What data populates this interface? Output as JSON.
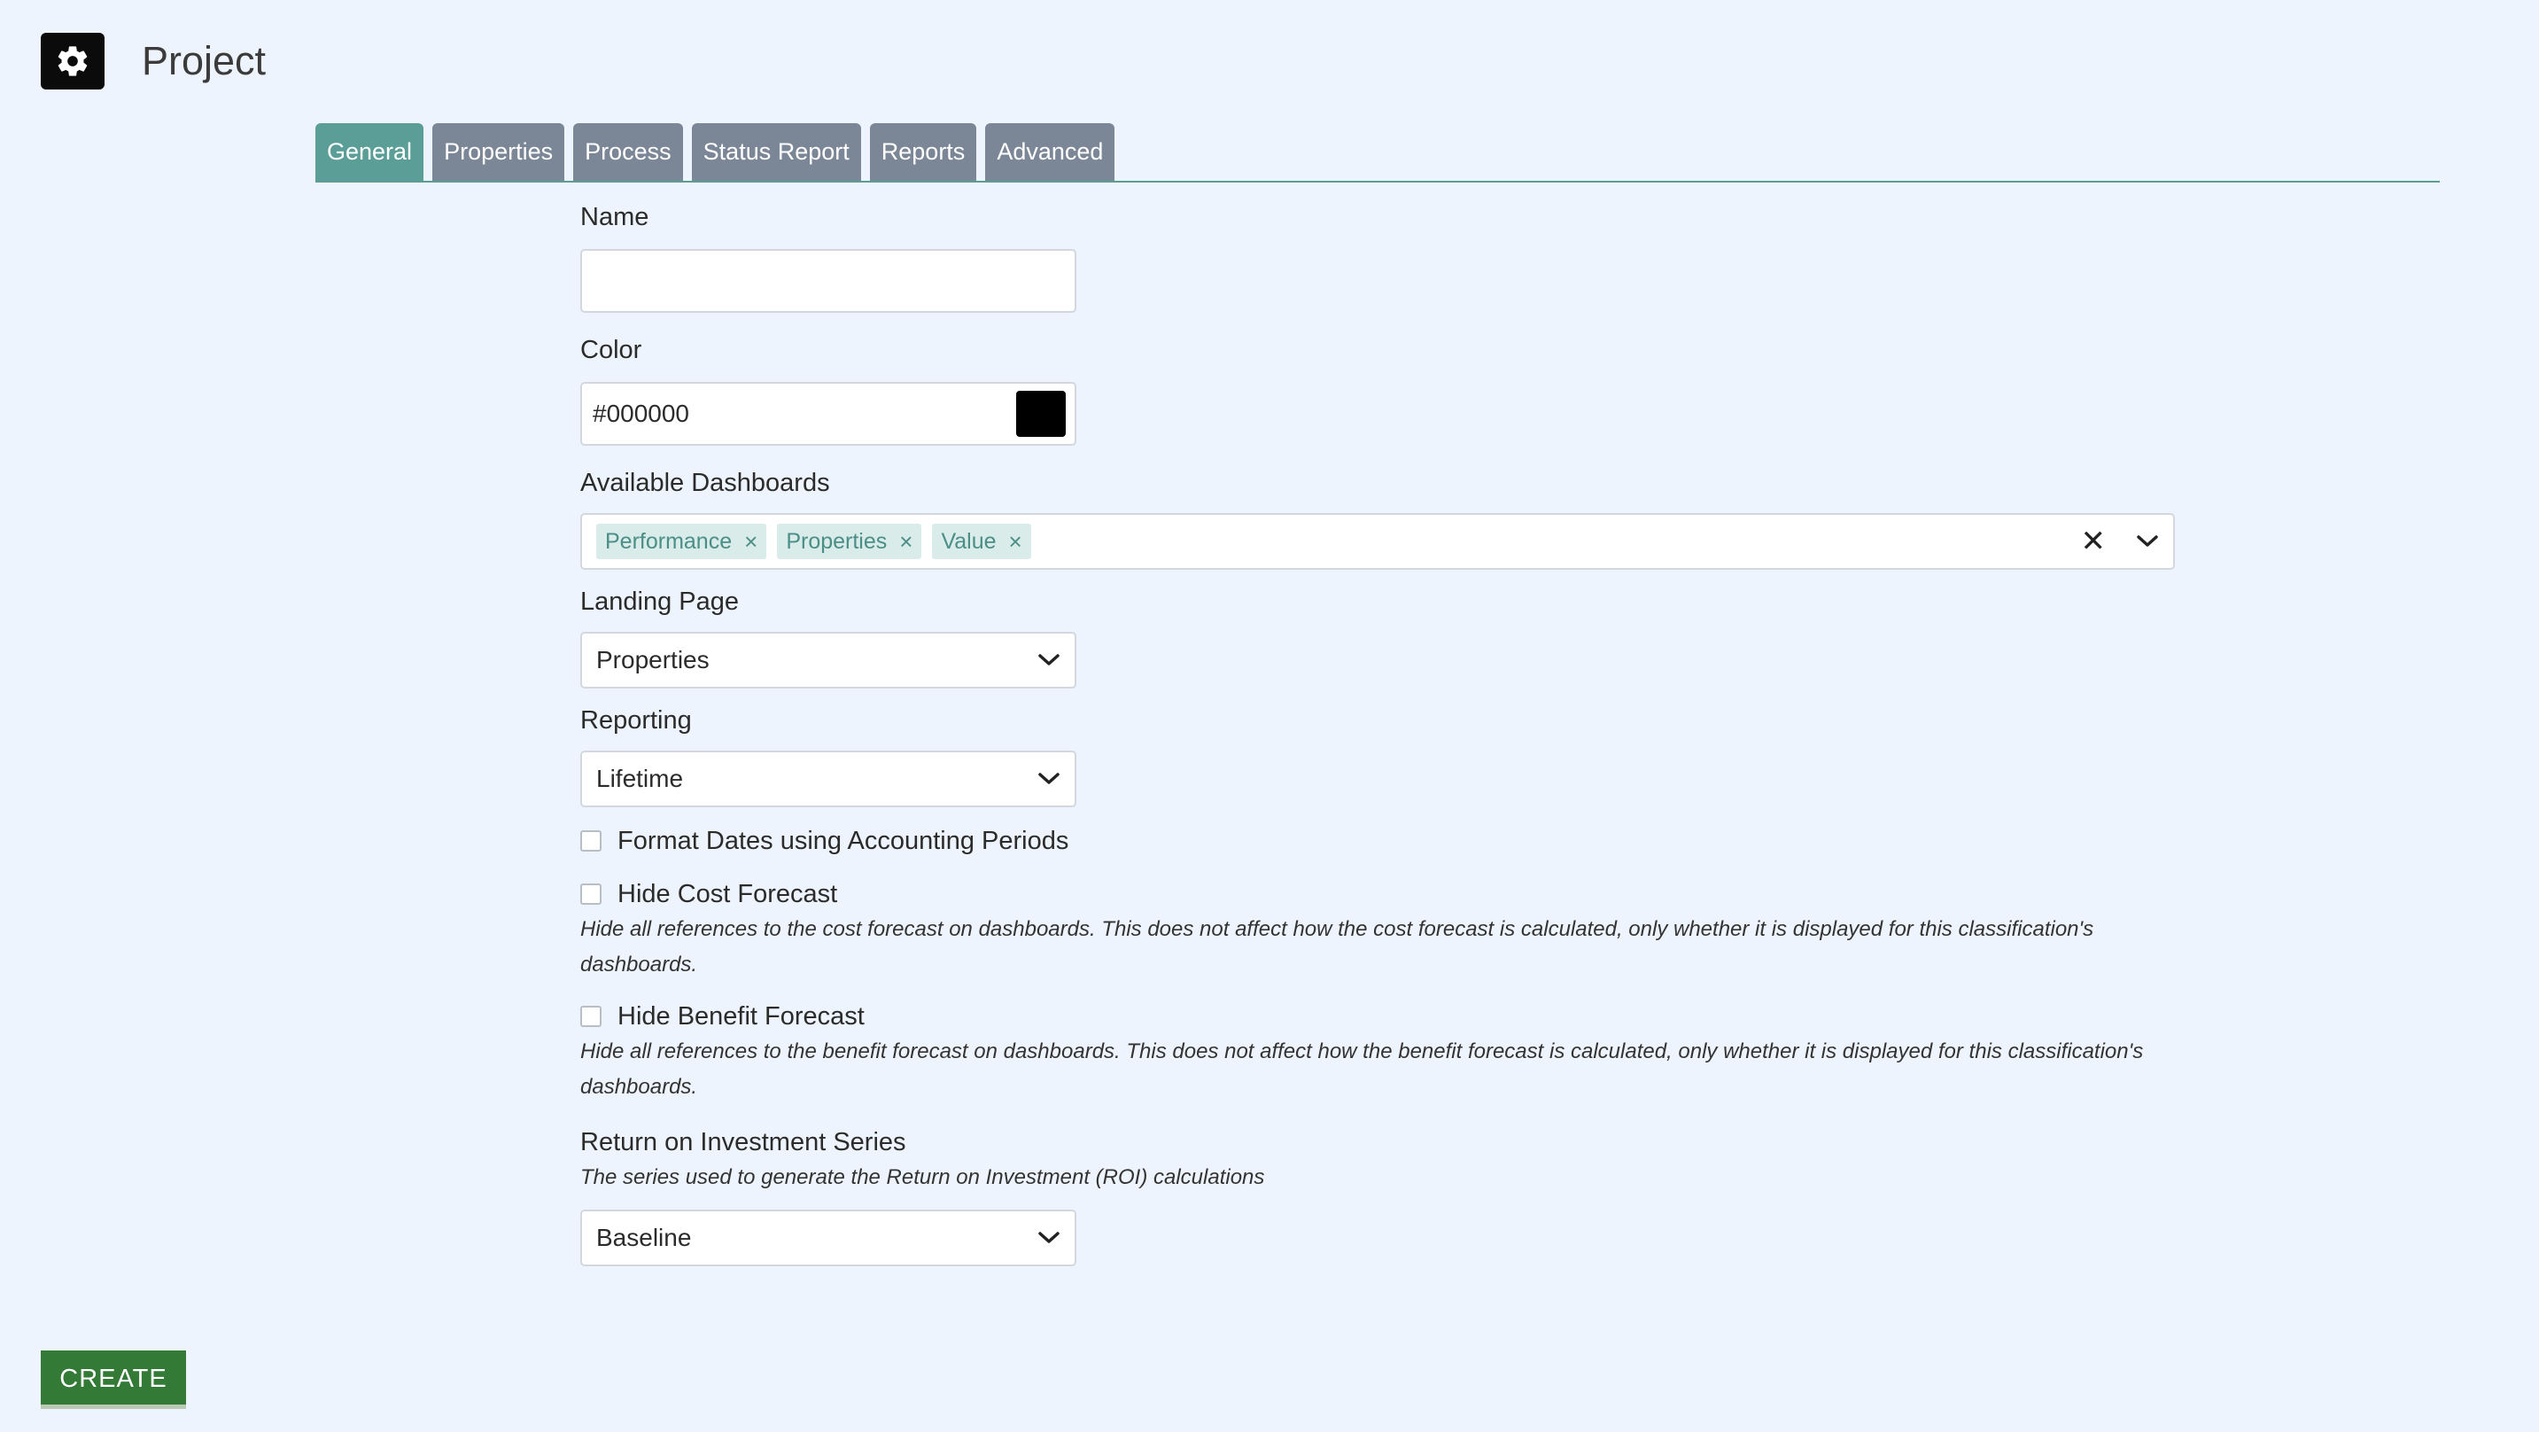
{
  "header": {
    "title": "Project",
    "icon": "gear-icon"
  },
  "tabs": [
    {
      "label": "General",
      "active": true
    },
    {
      "label": "Properties",
      "active": false
    },
    {
      "label": "Process",
      "active": false
    },
    {
      "label": "Status Report",
      "active": false
    },
    {
      "label": "Reports",
      "active": false
    },
    {
      "label": "Advanced",
      "active": false
    }
  ],
  "form": {
    "name": {
      "label": "Name",
      "value": ""
    },
    "color": {
      "label": "Color",
      "value": "#000000",
      "swatch": "#000000"
    },
    "dashboards": {
      "label": "Available Dashboards",
      "chips": [
        "Performance",
        "Properties",
        "Value"
      ],
      "chip_remove": "×",
      "clear": "✕"
    },
    "landing_page": {
      "label": "Landing Page",
      "value": "Properties"
    },
    "reporting": {
      "label": "Reporting",
      "value": "Lifetime"
    },
    "format_dates": {
      "label": "Format Dates using Accounting Periods",
      "checked": false
    },
    "hide_cost": {
      "label": "Hide Cost Forecast",
      "checked": false,
      "help": "Hide all references to the cost forecast on dashboards. This does not affect how the cost forecast is calculated, only whether it is displayed for this classification's dashboards."
    },
    "hide_benefit": {
      "label": "Hide Benefit Forecast",
      "checked": false,
      "help": "Hide all references to the benefit forecast on dashboards. This does not affect how the benefit forecast is calculated, only whether it is displayed for this classification's dashboards."
    },
    "roi": {
      "label": "Return on Investment Series",
      "help": "The series used to generate the Return on Investment (ROI) calculations",
      "value": "Baseline"
    }
  },
  "actions": {
    "create_label": "CREATE"
  },
  "colors": {
    "page_bg": "#edf4fd",
    "tab_active": "#5a9e97",
    "tab_inactive": "#7b8796",
    "create_button": "#327a35"
  }
}
